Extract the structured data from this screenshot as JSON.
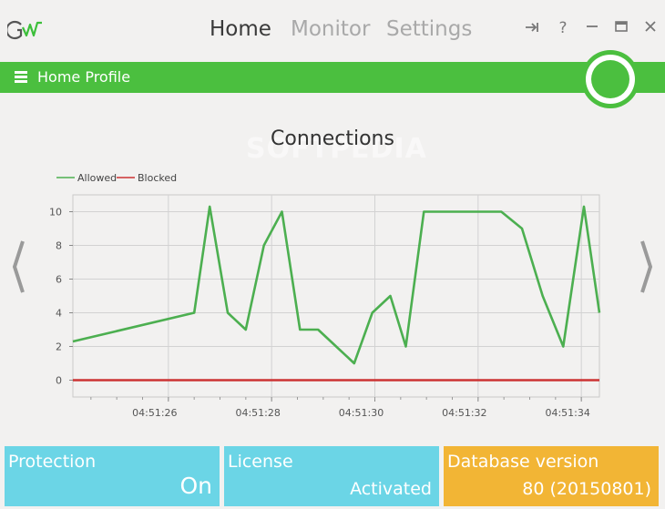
{
  "app": {
    "logo_icon": "gw-logo-icon"
  },
  "nav": {
    "tabs": [
      {
        "label": "Home",
        "active": true
      },
      {
        "label": "Monitor",
        "active": false
      },
      {
        "label": "Settings",
        "active": false
      }
    ]
  },
  "window_controls": [
    {
      "name": "pin-icon",
      "glyph": "⇥"
    },
    {
      "name": "help-icon",
      "glyph": "?"
    },
    {
      "name": "minimize-icon",
      "glyph": "–"
    },
    {
      "name": "maximize-icon",
      "glyph": "□"
    },
    {
      "name": "close-icon",
      "glyph": "✕"
    }
  ],
  "profile": {
    "name": "Home Profile",
    "status": "active"
  },
  "chart_section": {
    "title": "Connections",
    "watermark": "SOFTPEDIA"
  },
  "chart_data": {
    "type": "line",
    "title": "Connections",
    "legend": [
      "Allowed",
      "Blocked"
    ],
    "legend_position": "top-left",
    "grid": true,
    "x_ticks": [
      "04:51:26",
      "04:51:28",
      "04:51:30",
      "04:51:32",
      "04:51:34"
    ],
    "y_ticks": [
      0,
      2,
      4,
      6,
      8,
      10
    ],
    "ylim": [
      -1,
      11
    ],
    "xlim": [
      24.15,
      34.35
    ],
    "series": [
      {
        "name": "Allowed",
        "color": "#4caf50",
        "x": [
          24.15,
          26.5,
          26.8,
          27.15,
          27.5,
          27.85,
          28.2,
          28.55,
          28.9,
          29.25,
          29.6,
          29.95,
          30.3,
          30.6,
          30.95,
          31.25,
          31.65,
          32.05,
          32.45,
          32.85,
          33.25,
          33.65,
          34.05,
          34.35
        ],
        "y": [
          2.3,
          4.0,
          10.3,
          4.0,
          3.0,
          8.0,
          10.0,
          3.0,
          3.0,
          2.0,
          1.0,
          4.0,
          5.0,
          2.0,
          10.0,
          10.0,
          10.0,
          10.0,
          10.0,
          9.0,
          5.0,
          2.0,
          10.3,
          4.0
        ]
      },
      {
        "name": "Blocked",
        "color": "#cc3333",
        "x": [
          24.15,
          34.35
        ],
        "y": [
          0,
          0
        ]
      }
    ]
  },
  "side_nav": {
    "prev": "chevron-left-icon",
    "next": "chevron-right-icon"
  },
  "tiles": [
    {
      "label": "Protection",
      "value": "On",
      "color": "#6bd5e6"
    },
    {
      "label": "License",
      "value": "Activated",
      "color": "#6bd5e6"
    },
    {
      "label": "Database version",
      "value": "80 (20150801)",
      "color": "#f2b535"
    }
  ]
}
